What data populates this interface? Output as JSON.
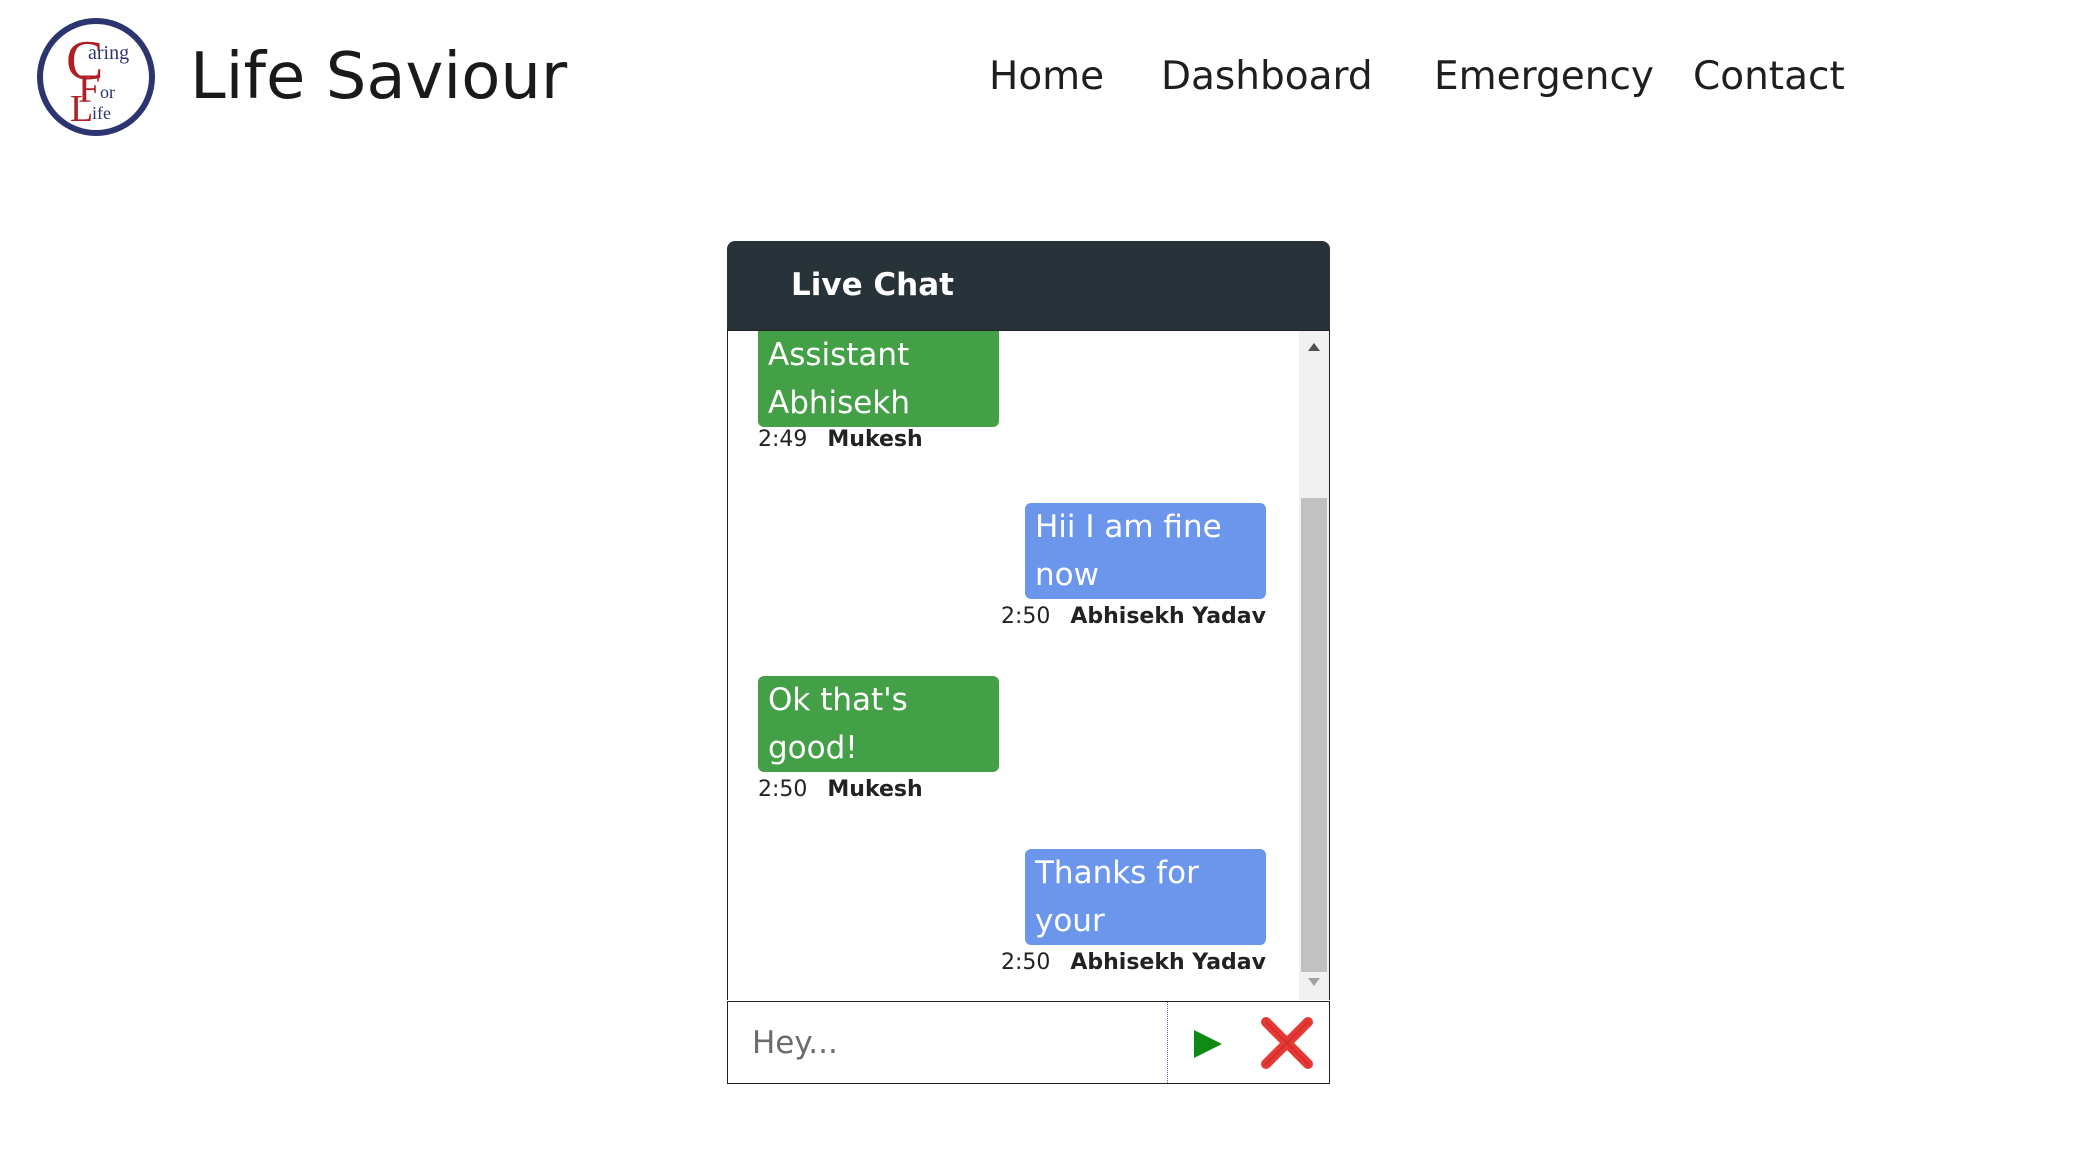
{
  "header": {
    "logo_letters": [
      "C",
      "aring",
      "F",
      "or",
      "L",
      "ife"
    ],
    "brand": "Life Saviour",
    "nav": [
      {
        "label": "Home"
      },
      {
        "label": "Dashboard"
      },
      {
        "label": "Emergency"
      },
      {
        "label": "Contact"
      }
    ]
  },
  "chat": {
    "title": "Live Chat",
    "messages": [
      {
        "side": "left",
        "text": "Assistant Abhisekh",
        "time": "2:49",
        "author": "Mukesh",
        "color": "#43a047"
      },
      {
        "side": "right",
        "text": "Hii I am fine now",
        "time": "2:50",
        "author": "Abhisekh Yadav",
        "color": "#6b96ec"
      },
      {
        "side": "left",
        "text": "Ok that's good!",
        "time": "2:50",
        "author": "Mukesh",
        "color": "#43a047"
      },
      {
        "side": "right",
        "text": "Thanks for your concern!!",
        "time": "2:50",
        "author": "Abhisekh Yadav",
        "color": "#6b96ec"
      }
    ],
    "input": {
      "placeholder": "Hey...",
      "value": ""
    },
    "send_icon": "play-triangle-icon",
    "close_icon": "red-x-icon"
  },
  "colors": {
    "header_bg": "#283339",
    "left_bubble": "#43a047",
    "right_bubble": "#6b96ec",
    "send": "#0f8a14",
    "close": "#e53935",
    "logo_ring": "#2c3570",
    "logo_letters": "#b01f24"
  }
}
